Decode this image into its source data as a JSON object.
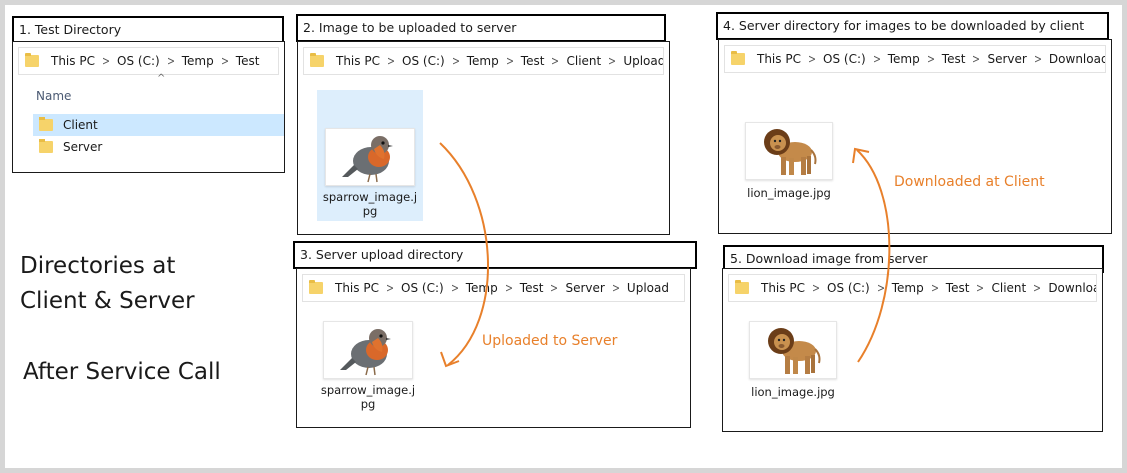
{
  "panel1": {
    "caption": "1. Test Directory",
    "breadcrumb": [
      "This PC",
      "OS (C:)",
      "Temp",
      "Test"
    ],
    "column_header": "Name",
    "items": [
      "Client",
      "Server"
    ]
  },
  "panel2": {
    "caption": "2. Image to be uploaded to server",
    "breadcrumb": [
      "This PC",
      "OS (C:)",
      "Temp",
      "Test",
      "Client",
      "Upload"
    ],
    "file_line1": "sparrow_image.j",
    "file_line2": "pg"
  },
  "panel3": {
    "caption": "3. Server upload directory",
    "breadcrumb": [
      "This PC",
      "OS (C:)",
      "Temp",
      "Test",
      "Server",
      "Upload"
    ],
    "file_line1": "sparrow_image.j",
    "file_line2": "pg"
  },
  "panel4": {
    "caption": "4. Server directory for images to be downloaded by client",
    "breadcrumb": [
      "This PC",
      "OS (C:)",
      "Temp",
      "Test",
      "Server",
      "Download"
    ],
    "file_name": "lion_image.jpg"
  },
  "panel5": {
    "caption": "5. Download image from server",
    "breadcrumb": [
      "This PC",
      "OS (C:)",
      "Temp",
      "Test",
      "Client",
      "Download"
    ],
    "file_name": "lion_image.jpg"
  },
  "annotations": {
    "uploaded": "Uploaded to Server",
    "downloaded": "Downloaded at Client"
  },
  "side_text": {
    "line1": "Directories at",
    "line2": "Client & Server",
    "line3": "After Service Call"
  },
  "colors": {
    "arrow": "#e8802b",
    "folder": "#f6d36a",
    "selection": "#cce8ff"
  }
}
